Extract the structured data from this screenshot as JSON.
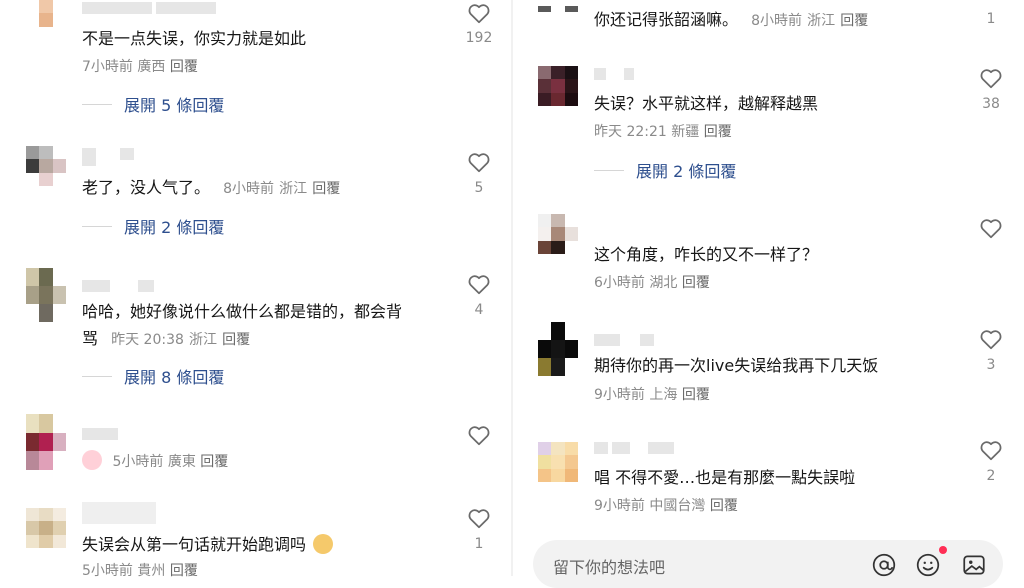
{
  "left_comments": [
    {
      "text": "不是一点失误，你实力就是如此",
      "time": "7小時前",
      "region": "廣西",
      "reply": "回覆",
      "likes": "192",
      "expand": "展開 5 條回覆"
    },
    {
      "text": "老了，没人气了。",
      "time": "8小時前",
      "region": "浙江",
      "reply": "回覆",
      "likes": "5",
      "expand": "展開 2 條回覆"
    },
    {
      "text": "哈哈，她好像说什么做什么都是错的，都会背",
      "text2": "骂",
      "time": "昨天 20:38",
      "region": "浙江",
      "reply": "回覆",
      "likes": "4",
      "expand": "展開 8 條回覆"
    },
    {
      "text": "",
      "time": "5小時前",
      "region": "廣東",
      "reply": "回覆",
      "likes": "",
      "emoji": "crying-face-icon"
    },
    {
      "text": "失误会从第一句话就开始跑调吗",
      "time": "5小時前",
      "region": "貴州",
      "reply": "回覆",
      "likes": "1",
      "emoji": "laughing-face-icon"
    }
  ],
  "right_comments": [
    {
      "text": "你还记得张韶涵嘛。",
      "time": "8小時前",
      "region": "浙江",
      "reply": "回覆",
      "likes": "1"
    },
    {
      "text": "失误？水平就这样，越解释越黑",
      "time": "昨天 22:21",
      "region": "新疆",
      "reply": "回覆",
      "likes": "38",
      "expand": "展開 2 條回覆"
    },
    {
      "text": "这个角度，咋长的又不一样了？",
      "time": "6小時前",
      "region": "湖北",
      "reply": "回覆",
      "likes": ""
    },
    {
      "text": "期待你的再一次live失误给我再下几天饭",
      "time": "9小時前",
      "region": "上海",
      "reply": "回覆",
      "likes": "3"
    },
    {
      "text": "唱 不得不愛…也是有那麼一點失誤啦",
      "time": "9小時前",
      "region": "中國台灣",
      "reply": "回覆",
      "likes": "2"
    }
  ],
  "input": {
    "placeholder": "留下你的想法吧"
  },
  "colors": {
    "link": "#2e4f8e",
    "meta": "#8a8a8a",
    "like_outline": "#6a6a6a",
    "notification_dot": "#ff2e55"
  }
}
